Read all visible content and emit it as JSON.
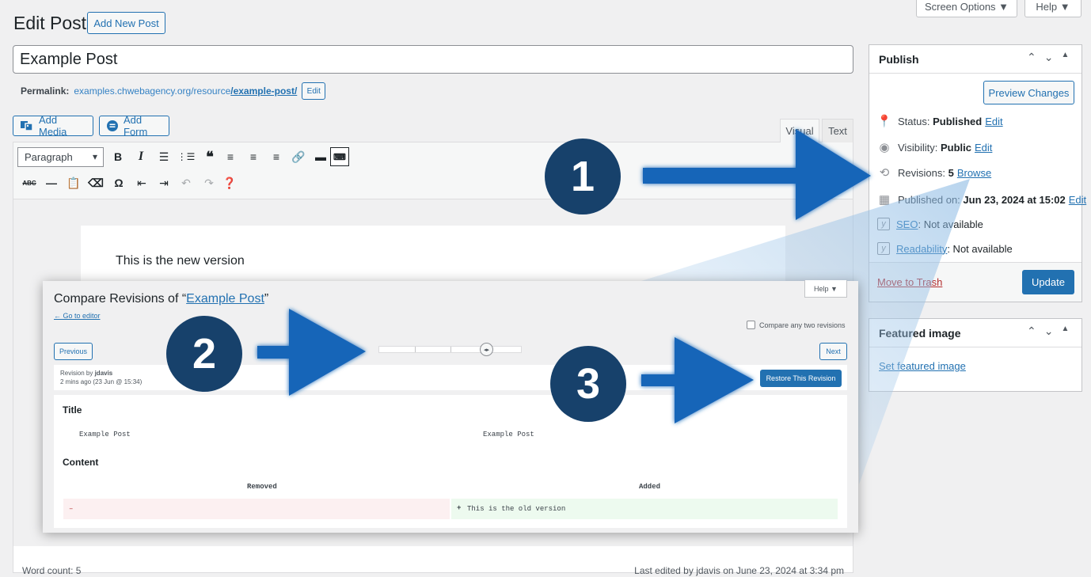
{
  "page": {
    "title": "Edit Post",
    "add_new_label": "Add New Post",
    "screen_options_label": "Screen Options ▼",
    "help_label": "Help ▼"
  },
  "post": {
    "title_value": "Example Post",
    "permalink_label": "Permalink:",
    "permalink_base": "examples.chwebagency.org/resource",
    "permalink_slug": "/example-post/",
    "permalink_edit": "Edit"
  },
  "media": {
    "add_media_label": "Add Media",
    "add_form_label": "Add Form"
  },
  "editor": {
    "tab_visual": "Visual",
    "tab_text": "Text",
    "format_select": "Paragraph",
    "content_text": "This is the new version",
    "word_count": "Word count: 5",
    "last_edited": "Last edited by jdavis on June 23, 2024 at 3:34 pm"
  },
  "publish": {
    "heading": "Publish",
    "preview_label": "Preview Changes",
    "status_label": "Status:",
    "status_value": "Published",
    "visibility_label": "Visibility:",
    "visibility_value": "Public",
    "revisions_label": "Revisions:",
    "revisions_count": "5",
    "browse_label": "Browse",
    "published_label": "Published on:",
    "published_value": "Jun 23, 2024 at 15:02",
    "seo_link": "SEO",
    "seo_value": ": Not available",
    "readability_link": "Readability",
    "readability_value": ": Not available",
    "edit_label": "Edit",
    "trash_label": "Move to Trash",
    "update_label": "Update"
  },
  "featured": {
    "heading": "Featured image",
    "set_label": "Set featured image"
  },
  "revisions": {
    "title_prefix": "Compare Revisions of “",
    "title_link": "Example Post",
    "title_suffix": "”",
    "back_link": "← Go to editor",
    "help_label": "Help ▼",
    "compare_label": "Compare any two revisions",
    "previous_label": "Previous",
    "next_label": "Next",
    "revision_by_prefix": "Revision by ",
    "revision_author": "jdavis",
    "revision_time": "2 mins ago (23 Jun @ 15:34)",
    "restore_label": "Restore This Revision",
    "title_heading": "Title",
    "title_old": "Example Post",
    "title_new": "Example Post",
    "content_heading": "Content",
    "removed_heading": "Removed",
    "added_heading": "Added",
    "removed_marker": "–",
    "added_marker": "+",
    "added_text": "This is the old version"
  },
  "callouts": [
    "1",
    "2",
    "3"
  ],
  "colors": {
    "accent": "#2271b1",
    "callout_badge": "#17416b",
    "arrow": "#1565b8",
    "removed_bg": "#fcf0f1",
    "added_bg": "#edfaef"
  },
  "icons": {
    "status": "pin-icon",
    "visibility": "eye-icon",
    "revisions": "history-icon",
    "published": "calendar-icon",
    "seo": "yoast-icon"
  }
}
